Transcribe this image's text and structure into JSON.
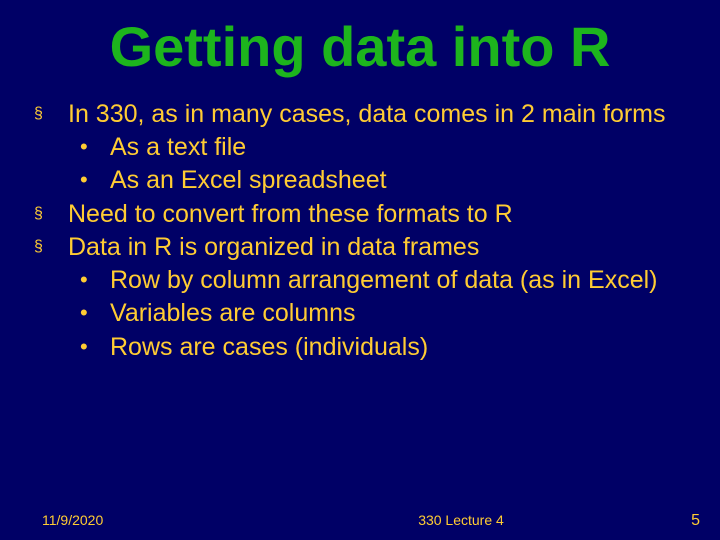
{
  "title": "Getting data into R",
  "bullets": {
    "b1": "In 330, as in many cases, data comes in 2 main forms",
    "b1a": "As a text file",
    "b1b": "As an Excel spreadsheet",
    "b2": "Need to convert from these formats to R",
    "b3": "Data in R is organized in data frames",
    "b3a": "Row by column arrangement of data (as in Excel)",
    "b3b": "Variables are columns",
    "b3c": "Rows are cases (individuals)"
  },
  "footer": {
    "date": "11/9/2020",
    "center": "330 Lecture 4",
    "page": "5"
  }
}
